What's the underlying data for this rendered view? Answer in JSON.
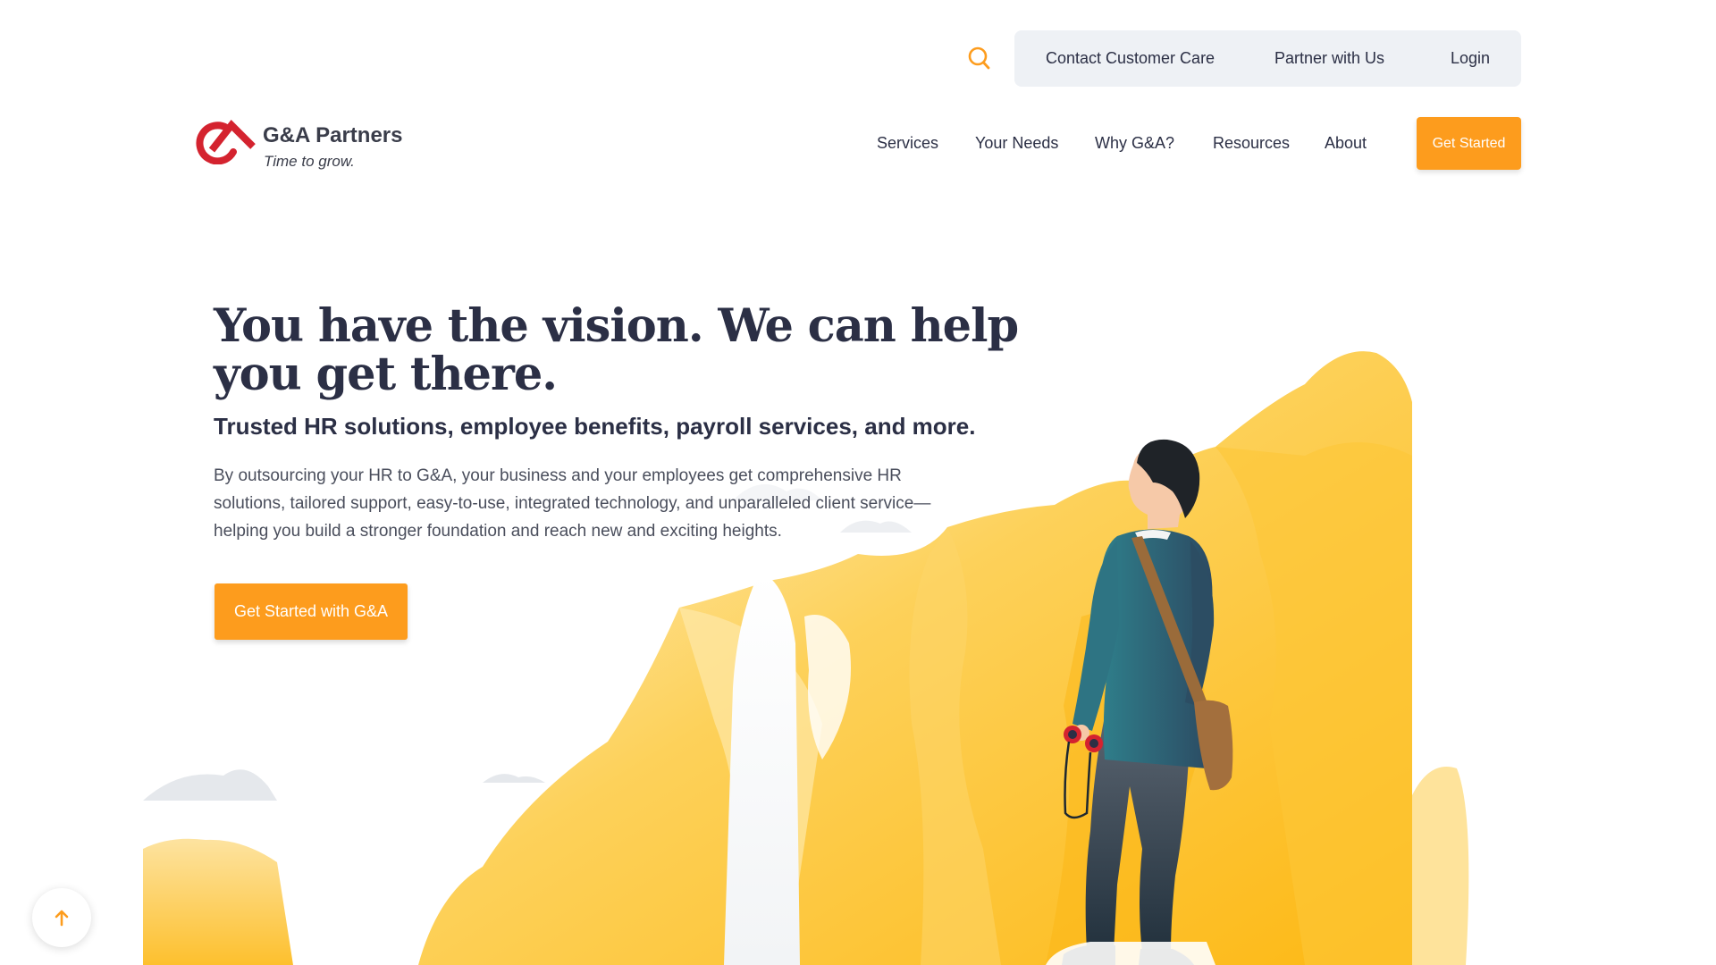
{
  "utility_nav": {
    "search_icon": "search-icon",
    "links": [
      {
        "label": "Contact Customer Care"
      },
      {
        "label": "Partner with Us"
      },
      {
        "label": "Login"
      }
    ]
  },
  "logo": {
    "name": "G&A Partners",
    "tagline": "Time to grow."
  },
  "main_nav": {
    "items": [
      {
        "label": "Services"
      },
      {
        "label": "Your Needs"
      },
      {
        "label": "Why G&A?"
      },
      {
        "label": "Resources"
      },
      {
        "label": "About"
      }
    ],
    "cta_label": "Get Started"
  },
  "hero": {
    "title": "You have the vision. We can help you get there.",
    "subtitle": "Trusted HR solutions, employee benefits, payroll services, and more.",
    "body": "By outsourcing your HR to G&A, your business and your employees get comprehensive HR solutions, tailored support, easy-to-use, integrated technology, and unparalleled client service—helping you build a stronger foundation and reach new and exciting heights.",
    "cta_label": "Get Started with G&A"
  },
  "back_to_top": {
    "icon": "arrow-up-icon"
  },
  "colors": {
    "accent": "#fd9c1d",
    "heading": "#2b2f45",
    "logo_red": "#d4232f",
    "mountain_yellow": "#fdbb1a",
    "utility_bg": "#eef1f5"
  }
}
